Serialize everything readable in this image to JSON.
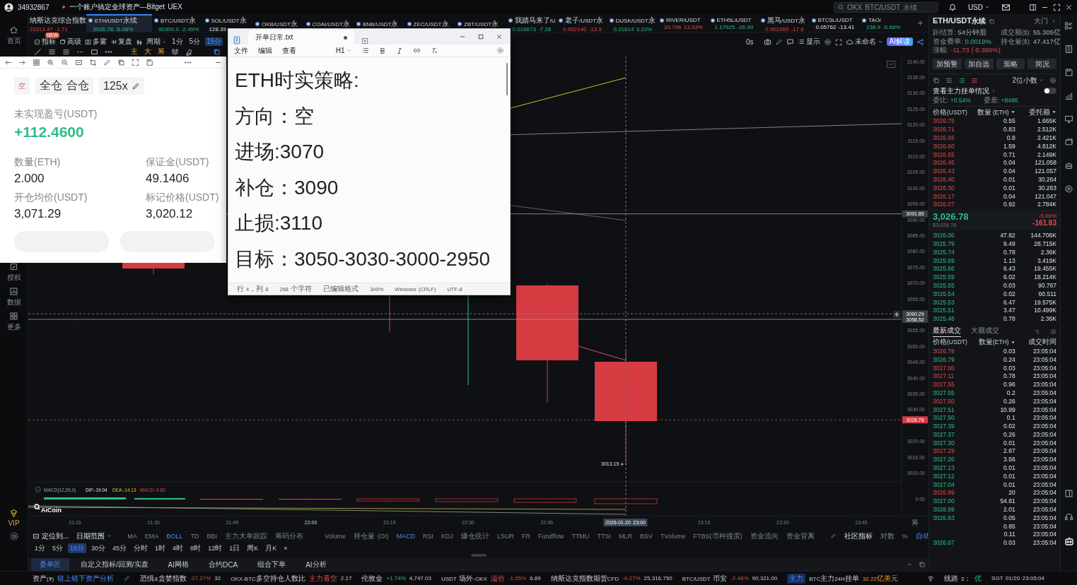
{
  "top_bar": {
    "account": "34932867",
    "slogan": "一个账户搞定全球资产---Bitget UEX",
    "search": {
      "placeholder": "OKX BTC/USDT 永续"
    },
    "currency": "USD"
  },
  "left_rail": [
    {
      "label": "首页",
      "kind": "home"
    },
    {
      "label": "授权",
      "kind": "auth"
    },
    {
      "label": "数据",
      "kind": "data"
    },
    {
      "label": "更多",
      "kind": "more"
    },
    {
      "label": "VIP",
      "kind": "vip"
    }
  ],
  "tickers": [
    {
      "kind": "index",
      "name": "纳斯达克综合指数",
      "price": "23113.47",
      "change": "-1.71",
      "rising": false,
      "selected": false
    },
    {
      "kind": "pair",
      "name": "ETH/USDT永续",
      "price": "3026.78",
      "change": "-5.08%",
      "rising": true,
      "selected": true
    },
    {
      "kind": "pair",
      "name": "BTC/USDT永",
      "price": "90300.0",
      "change": "-2.49%",
      "rising": true,
      "selected": false
    },
    {
      "kind": "pair",
      "name": "SOL/USDT永",
      "price": "128.39",
      "selected": false
    },
    {
      "kind": "pair",
      "name": "OKB/USDT永",
      "selected": false
    },
    {
      "kind": "pair",
      "name": "COAI/USDT永",
      "selected": false
    },
    {
      "kind": "pair",
      "name": "BNB/USDT永",
      "selected": false
    },
    {
      "kind": "pair",
      "name": "ZEC/USDT永",
      "selected": false
    },
    {
      "kind": "pair",
      "name": "ZBT/USDT永",
      "selected": false
    },
    {
      "kind": "pair",
      "name": "我踏马来了/U",
      "price": "0.016673",
      "change": "-7.28",
      "rising": true,
      "selected": false
    },
    {
      "kind": "pair",
      "name": "老子/USDT永",
      "price": "0.002140",
      "change": "-13.9",
      "rising": false,
      "selected": false
    },
    {
      "kind": "pair",
      "name": "DUSK/USDT永",
      "price": "0.21614",
      "change": "3.33%",
      "rising": true,
      "selected": false
    },
    {
      "kind": "pair",
      "name": "RIVER/USDT",
      "price": "33.796",
      "change": "13.33%",
      "rising": false,
      "selected": false
    },
    {
      "kind": "pair",
      "name": "ETH5L/USDT",
      "price": "1.17925",
      "change": "-26.99",
      "rising": true,
      "selected": false
    },
    {
      "kind": "pair",
      "name": "黑马/USDT永",
      "price": "0.002260",
      "change": "-17.6",
      "rising": false,
      "selected": false
    },
    {
      "kind": "pair",
      "name": "BTC5L/USDT",
      "price": "0.05762",
      "change": "-13.41",
      "selected": false
    },
    {
      "kind": "pair",
      "name": "TAO/",
      "price": "238.9",
      "change": "-5.68%",
      "rising": true,
      "selected": false
    }
  ],
  "ticker_add": "+",
  "chart_toolbar": {
    "tools": [
      {
        "label": "指标",
        "badge": "NEW"
      },
      {
        "label": "高级"
      },
      {
        "label": "多窗"
      },
      {
        "label": "复盘"
      }
    ],
    "period_label": "周期",
    "periods": [
      {
        "label": "1分",
        "selected": false
      },
      {
        "label": "5分",
        "selected": false
      },
      {
        "label": "15分",
        "selected": true
      }
    ],
    "timer": "0s",
    "display": "显示",
    "layout": "未命名",
    "ai": "AI解读",
    "letters": [
      "主",
      "大",
      "筹"
    ]
  },
  "chart": {
    "price_axis": [
      "3140.00",
      "3135.00",
      "3130.00",
      "3125.00",
      "3120.00",
      "3115.00",
      "3110.00",
      "3105.00",
      "3100.00",
      "3095.00",
      "3090.00",
      "3085.00",
      "3080.00",
      "3075.00",
      "3070.00",
      "3065.00",
      "3055.00",
      "3050.00",
      "3045.00",
      "3040.00",
      "3035.00",
      "3030.00",
      "3020.00",
      "3015.00",
      "3010.00"
    ],
    "price_tags": [
      {
        "value": "3091.85",
        "kind": "line"
      },
      {
        "value": "3060.29",
        "kind": "cross"
      },
      {
        "value": "3058.52",
        "kind": "line"
      },
      {
        "value": "3026.78",
        "kind": "last"
      }
    ],
    "low_label": "3013.15",
    "macd": {
      "name": "MACD(12,26,9)",
      "dif": "DIF:-19.04",
      "dea": "DEA:-14.13",
      "macd": "MACD:-9.82",
      "axis": "0.00"
    },
    "logo": "AiCoin",
    "time_axis": [
      {
        "label": "21:15",
        "kind": "tick"
      },
      {
        "label": "21:30",
        "kind": "tick"
      },
      {
        "label": "21:45",
        "kind": "tick"
      },
      {
        "label": "22:00",
        "kind": "major"
      },
      {
        "label": "22:15",
        "kind": "tick"
      },
      {
        "label": "22:30",
        "kind": "tick"
      },
      {
        "label": "22:45",
        "kind": "tick"
      },
      {
        "label": "2026-01-20 23:00",
        "kind": "crosshair"
      },
      {
        "label": "23:15",
        "kind": "tick"
      },
      {
        "label": "23:30",
        "kind": "tick"
      },
      {
        "label": "23:45",
        "kind": "tick"
      }
    ],
    "axis_corner": "筹"
  },
  "indicator_bar": {
    "locate": "定位到...",
    "date_range": "日期范围",
    "main": [
      {
        "label": "MA",
        "selected": false
      },
      {
        "label": "EMA",
        "selected": false
      },
      {
        "label": "BOLL",
        "selected": true
      },
      {
        "label": "TD",
        "selected": false
      },
      {
        "label": "BBI",
        "selected": false
      },
      {
        "label": "主力大单跟踪",
        "selected": false
      },
      {
        "label": "筹码分布",
        "selected": false
      }
    ],
    "sub": [
      {
        "label": "Volume",
        "selected": false
      },
      {
        "label": "持仓量 (OI)",
        "selected": false
      },
      {
        "label": "MACD",
        "selected": true
      },
      {
        "label": "RSI",
        "selected": false
      },
      {
        "label": "KDJ",
        "selected": false
      },
      {
        "label": "爆仓统计",
        "selected": false
      },
      {
        "label": "LSUR",
        "selected": false
      },
      {
        "label": "FR",
        "selected": false
      },
      {
        "label": "Fundflow",
        "selected": false
      },
      {
        "label": "TTMU",
        "selected": false
      },
      {
        "label": "TTSI",
        "selected": false
      },
      {
        "label": "MLR",
        "selected": false
      },
      {
        "label": "BSV",
        "selected": false
      },
      {
        "label": "TVolume",
        "selected": false
      },
      {
        "label": "FTBS(币种搜度)",
        "selected": false
      },
      {
        "label": "资金流向",
        "selected": false
      },
      {
        "label": "资金背离",
        "selected": false
      }
    ],
    "community": "社区指标",
    "log": "对数",
    "percent": "%",
    "auto": {
      "label": "自动",
      "on": true
    }
  },
  "periods_bar": {
    "items": [
      {
        "label": "1分",
        "selected": false
      },
      {
        "label": "5分",
        "selected": false
      },
      {
        "label": "15分",
        "selected": true
      },
      {
        "label": "30分",
        "selected": false
      },
      {
        "label": "45分",
        "selected": false
      },
      {
        "label": "分时",
        "selected": false
      },
      {
        "label": "1时",
        "selected": false
      },
      {
        "label": "4时",
        "selected": false
      },
      {
        "label": "8时",
        "selected": false
      },
      {
        "label": "12时",
        "selected": false
      },
      {
        "label": "1日",
        "selected": false
      },
      {
        "label": "周K",
        "selected": false
      },
      {
        "label": "月K",
        "selected": false
      }
    ],
    "close": "×"
  },
  "bottom_tabs": [
    {
      "label": "委单区",
      "selected": true
    },
    {
      "label": "自定义指标/回测/实盘",
      "selected": false
    },
    {
      "label": "AI网格",
      "selected": false
    },
    {
      "label": "合约DCA",
      "selected": false
    },
    {
      "label": "组合下单",
      "selected": false
    },
    {
      "label": "AI分析",
      "selected": false
    }
  ],
  "status_bar": {
    "groups": [
      {
        "parts": [
          {
            "text": "资产(₮)",
            "kind": "plain"
          },
          {
            "text": "链上链下资产分析",
            "kind": "link"
          }
        ]
      },
      {
        "parts": [
          {
            "text": "恐惧&贪婪指数",
            "kind": "plain"
          },
          {
            "text": "-27.27%",
            "kind": "down"
          },
          {
            "text": "32",
            "kind": "plain"
          }
        ]
      },
      {
        "parts": [
          {
            "text": "OKX-BTC多空持仓人数比",
            "kind": "plain"
          },
          {
            "text": "主力看空",
            "kind": "down"
          },
          {
            "text": "2.17",
            "kind": "plain"
          }
        ]
      },
      {
        "parts": [
          {
            "text": "伦敦金",
            "kind": "plain"
          },
          {
            "text": "+1.74%",
            "kind": "up"
          },
          {
            "text": "4,747.03",
            "kind": "plain"
          }
        ]
      },
      {
        "parts": [
          {
            "text": "USDT 场外-OKX",
            "kind": "plain"
          },
          {
            "text": "溢价",
            "kind": "down"
          },
          {
            "text": "-1.05%",
            "kind": "down"
          },
          {
            "text": "6.89",
            "kind": "plain"
          }
        ]
      },
      {
        "parts": [
          {
            "text": "纳斯达克指数期货CFD",
            "kind": "plain"
          },
          {
            "text": "-0.27%",
            "kind": "down"
          },
          {
            "text": "25,316.750",
            "kind": "plain"
          }
        ]
      },
      {
        "parts": [
          {
            "text": "BTC/USDT 币安",
            "kind": "plain"
          },
          {
            "text": "-2.48%",
            "kind": "down"
          },
          {
            "text": "90,321.00",
            "kind": "plain"
          }
        ]
      },
      {
        "parts": [
          {
            "text": "主力",
            "kind": "badge"
          },
          {
            "text": "BTC主力24H挂单",
            "kind": "plain"
          },
          {
            "text": "32.22亿美元",
            "kind": "accent"
          }
        ]
      }
    ],
    "line_label": "线路 3：",
    "line_quality": "优",
    "clock": "SGT 01/20 23:05:04"
  },
  "market": {
    "symbol": "ETH/USDT永续",
    "link": "大门",
    "stats": [
      {
        "label": "距结算:",
        "value": "54分钟后",
        "kind": "plain"
      },
      {
        "label": "成交额($):",
        "value": "55.305亿",
        "kind": "plain"
      },
      {
        "label": "资金费率:",
        "value": "0.0019%",
        "kind": "up"
      },
      {
        "label": "持仓量($):",
        "value": "47.417亿",
        "kind": "plain"
      },
      {
        "label": "涨幅:",
        "value": "-11.73 (-0.386%)",
        "kind": "down"
      }
    ],
    "buttons": [
      "加预警",
      "加自选",
      "策略",
      "简况"
    ],
    "precision": "2位小数",
    "whale": {
      "label": "查看主力挂单情况",
      "on": false
    },
    "ratio": {
      "label": "委比:",
      "value": "+0.54%"
    },
    "diff": {
      "label": "委差:",
      "value": "+8486"
    },
    "columns": [
      "价格(USDT)",
      "数量 (ETH)",
      "委托额"
    ],
    "asks": [
      {
        "price": "3026.75",
        "qty": "0.55",
        "total": "1.665K"
      },
      {
        "price": "3026.71",
        "qty": "0.83",
        "total": "2.512K"
      },
      {
        "price": "3026.65",
        "qty": "0.8",
        "total": "2.421K"
      },
      {
        "price": "3026.60",
        "qty": "1.59",
        "total": "4.812K"
      },
      {
        "price": "3026.55",
        "qty": "0.71",
        "total": "2.149K"
      },
      {
        "price": "3026.46",
        "qty": "0.04",
        "total": "121.058"
      },
      {
        "price": "3026.43",
        "qty": "0.04",
        "total": "121.057"
      },
      {
        "price": "3026.40",
        "qty": "0.01",
        "total": "30.264"
      },
      {
        "price": "3026.30",
        "qty": "0.01",
        "total": "30.263"
      },
      {
        "price": "3026.17",
        "qty": "0.04",
        "total": "121.047"
      },
      {
        "price": "3026.07",
        "qty": "0.92",
        "total": "2.784K"
      }
    ],
    "last": {
      "price": "3,026.78",
      "usd": "$3,026.78",
      "change": "-5.08%",
      "change_abs": "-161.83"
    },
    "bids": [
      {
        "price": "3026.06",
        "qty": "47.82",
        "total": "144.706K"
      },
      {
        "price": "3025.79",
        "qty": "9.49",
        "total": "28.715K"
      },
      {
        "price": "3025.74",
        "qty": "0.78",
        "total": "2.36K"
      },
      {
        "price": "3025.69",
        "qty": "1.13",
        "total": "3.419K"
      },
      {
        "price": "3025.66",
        "qty": "6.43",
        "total": "19.455K"
      },
      {
        "price": "3025.59",
        "qty": "6.02",
        "total": "18.214K"
      },
      {
        "price": "3025.55",
        "qty": "0.03",
        "total": "90.767"
      },
      {
        "price": "3025.54",
        "qty": "0.02",
        "total": "60.511"
      },
      {
        "price": "3025.53",
        "qty": "6.47",
        "total": "19.575K"
      },
      {
        "price": "3025.51",
        "qty": "3.47",
        "total": "10.499K"
      },
      {
        "price": "3025.46",
        "qty": "0.78",
        "total": "2.36K"
      }
    ],
    "trade_tabs": [
      {
        "label": "最新成交",
        "selected": true
      },
      {
        "label": "大额成交",
        "selected": false
      }
    ],
    "trade_columns": [
      "价格(USDT)",
      "数量(ETH)",
      "成交时间"
    ],
    "trades": [
      {
        "price": "3026.78",
        "qty": "0.03",
        "time": "23:05:04",
        "buy": false
      },
      {
        "price": "3026.79",
        "qty": "0.24",
        "time": "23:05:04",
        "buy": true
      },
      {
        "price": "3027.00",
        "qty": "0.03",
        "time": "23:05:04",
        "buy": false
      },
      {
        "price": "3027.11",
        "qty": "0.78",
        "time": "23:05:04",
        "buy": false
      },
      {
        "price": "3027.55",
        "qty": "0.96",
        "time": "23:05:04",
        "buy": false
      },
      {
        "price": "3027.55",
        "qty": "0.2",
        "time": "23:05:04",
        "buy": true
      },
      {
        "price": "3027.50",
        "qty": "0.26",
        "time": "23:05:04",
        "buy": false
      },
      {
        "price": "3027.51",
        "qty": "10.99",
        "time": "23:05:04",
        "buy": true
      },
      {
        "price": "3027.50",
        "qty": "0.1",
        "time": "23:05:04",
        "buy": true
      },
      {
        "price": "3027.39",
        "qty": "0.02",
        "time": "23:05:04",
        "buy": true
      },
      {
        "price": "3027.37",
        "qty": "0.26",
        "time": "23:05:04",
        "buy": true
      },
      {
        "price": "3027.30",
        "qty": "0.01",
        "time": "23:05:04",
        "buy": true
      },
      {
        "price": "3027.29",
        "qty": "2.87",
        "time": "23:05:04",
        "buy": false
      },
      {
        "price": "3027.26",
        "qty": "3.56",
        "time": "23:05:04",
        "buy": true
      },
      {
        "price": "3027.13",
        "qty": "0.01",
        "time": "23:05:04",
        "buy": true
      },
      {
        "price": "3027.12",
        "qty": "0.01",
        "time": "23:05:04",
        "buy": true
      },
      {
        "price": "3027.04",
        "qty": "0.01",
        "time": "23:05:04",
        "buy": true
      },
      {
        "price": "3026.99",
        "qty": "20",
        "time": "23:05:04",
        "buy": false
      },
      {
        "price": "3027.00",
        "qty": "54.81",
        "time": "23:05:04",
        "buy": true
      },
      {
        "price": "3026.99",
        "qty": "2.01",
        "time": "23:05:04",
        "buy": true
      },
      {
        "price": "3026.83",
        "qty": "0.05",
        "time": "23:05:04",
        "buy": true
      },
      {
        "qty": "0.85",
        "time": "23:05:04"
      },
      {
        "qty": "0.11",
        "time": "23:05:04"
      },
      {
        "price": "3026.67",
        "qty": "0.03",
        "time": "23:05:04",
        "buy": true
      }
    ]
  },
  "position_card": {
    "side": "空",
    "margin_mode": "全仓",
    "position_mode": "合仓",
    "leverage": "125x",
    "pnl_label": "未实现盈亏(USDT)",
    "pnl": "+112.4600",
    "fields": [
      {
        "label": "数量(ETH)",
        "value": "2.000"
      },
      {
        "label": "保证金(USDT)",
        "value": "49.1406"
      },
      {
        "label": "开仓均价(USDT)",
        "value": "3,071.29"
      },
      {
        "label": "标记价格(USDT)",
        "value": "3,020.12"
      }
    ]
  },
  "notepad": {
    "tab": "开单日常.txt",
    "menu": [
      "文件",
      "编辑",
      "查看"
    ],
    "heading": "H1",
    "lines": [
      "ETH时实策略:",
      "方向：空",
      "进场:3070",
      "补仓：3090",
      "止损:3110",
      "目标：3050-3030-3000-2950"
    ],
    "status": [
      "行 4，列 8",
      "268 个字符",
      "已编辑格式",
      "340%",
      "Windows (CRLF)",
      "UTF-8"
    ]
  }
}
